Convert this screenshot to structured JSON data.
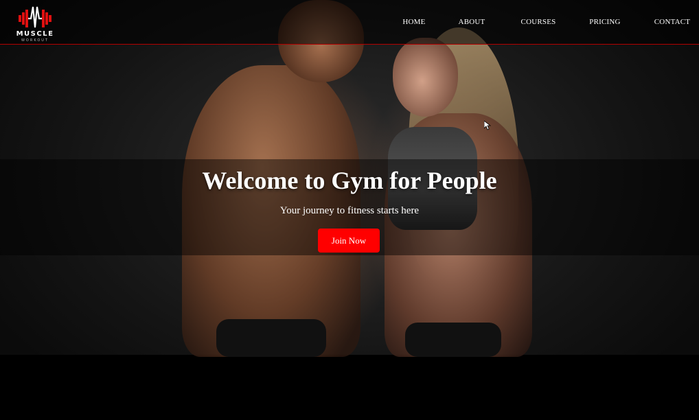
{
  "logo": {
    "text": "MUSCLE",
    "subtext": "WORKOUT"
  },
  "nav": {
    "items": [
      {
        "label": "HOME"
      },
      {
        "label": "ABOUT"
      },
      {
        "label": "COURSES"
      },
      {
        "label": "PRICING"
      },
      {
        "label": "CONTACT"
      }
    ]
  },
  "hero": {
    "title": "Welcome to Gym for People",
    "subtitle": "Your journey to fitness starts here",
    "cta_label": "Join Now"
  },
  "colors": {
    "accent": "#ff0000",
    "nav_border": "#b30000",
    "background": "#000000"
  }
}
